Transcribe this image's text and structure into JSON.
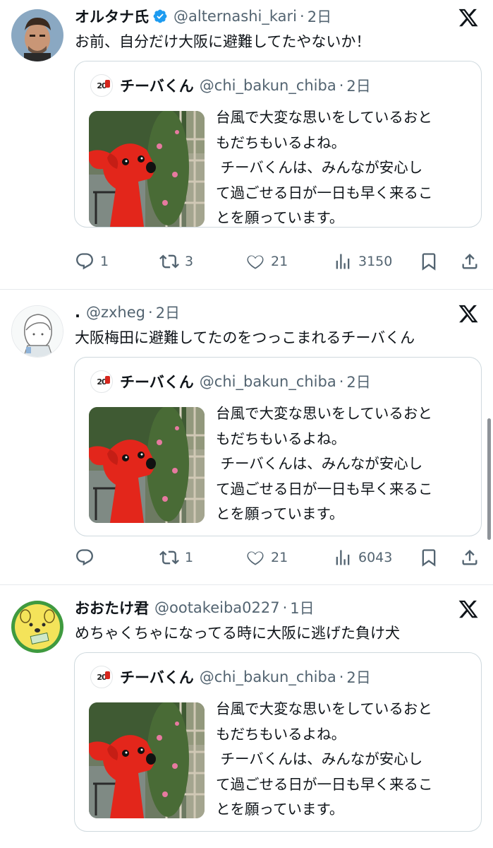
{
  "tweets": [
    {
      "name": "オルタナ氏",
      "verified": true,
      "handle": "@alternashi_kari",
      "time": "2日",
      "text": "お前、自分だけ大阪に避難してたやないか！",
      "quote": {
        "name": "チーバくん",
        "handle": "@chi_bakun_chiba",
        "time": "2日",
        "lines": [
          "台風で大変な思いをしているおと",
          "もだちもいるよね。",
          " チーバくんは、みんなが安心し",
          "て過ごせる日が一日も早く来るこ",
          "とを願っています。"
        ]
      },
      "actions": {
        "reply": "1",
        "retweet": "3",
        "like": "21",
        "views": "3150"
      }
    },
    {
      "name": ".",
      "verified": false,
      "handle": "@zxheg",
      "time": "2日",
      "text": "大阪梅田に避難してたのをつっこまれるチーバくん",
      "quote": {
        "name": "チーバくん",
        "handle": "@chi_bakun_chiba",
        "time": "2日",
        "lines": [
          "台風で大変な思いをしているおと",
          "もだちもいるよね。",
          " チーバくんは、みんなが安心し",
          "て過ごせる日が一日も早く来るこ",
          "とを願っています。"
        ]
      },
      "actions": {
        "reply": "",
        "retweet": "1",
        "like": "21",
        "views": "6043"
      }
    },
    {
      "name": "おおたけ君",
      "verified": false,
      "handle": "@ootakeiba0227",
      "time": "1日",
      "text": "めちゃくちゃになってる時に大阪に逃げた負け犬",
      "quote": {
        "name": "チーバくん",
        "handle": "@chi_bakun_chiba",
        "time": "2日",
        "lines": [
          "台風で大変な思いをしているおと",
          "もだちもいるよね。",
          " チーバくんは、みんなが安心し",
          "て過ごせる日が一日も早く来るこ",
          "とを願っています。"
        ]
      }
    }
  ],
  "quote_logo_text": "20",
  "icons": {
    "verified": "verified-badge-icon",
    "x": "x-logo-icon",
    "reply": "reply-icon",
    "retweet": "retweet-icon",
    "like": "heart-icon",
    "views": "views-chart-icon",
    "bookmark": "bookmark-icon",
    "share": "share-icon"
  },
  "colors": {
    "verified": "#1d9bf0",
    "muted": "#536471",
    "text": "#0f1419",
    "border": "#cfd9de",
    "mascot_red": "#e3261b"
  }
}
